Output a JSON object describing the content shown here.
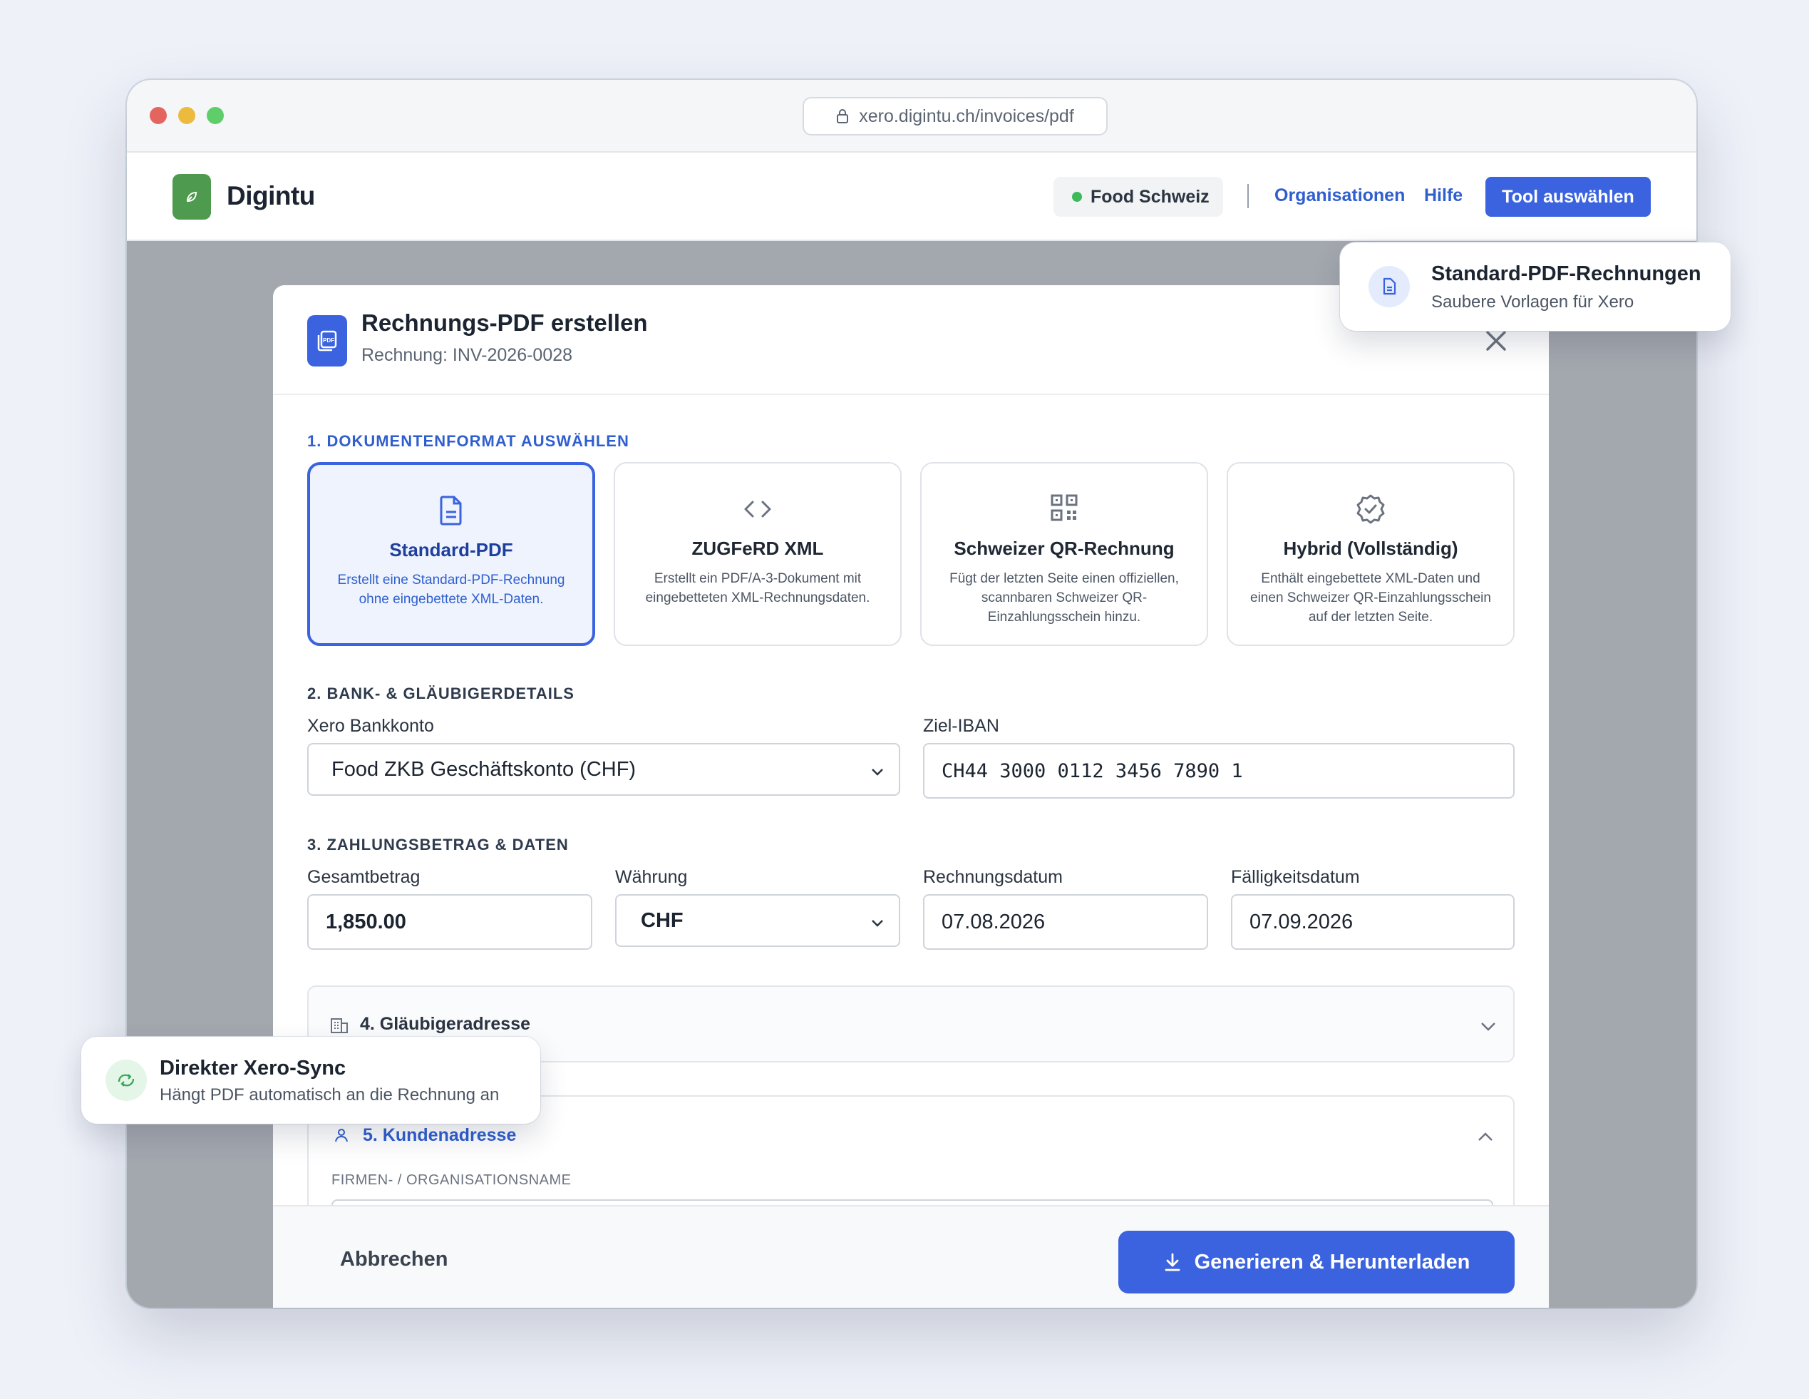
{
  "browser": {
    "url": "xero.digintu.ch/invoices/pdf",
    "dots": [
      "#e4655f",
      "#ecba3c",
      "#5fcd6a"
    ]
  },
  "header": {
    "brand": "Digintu",
    "org": "Food Schweiz",
    "nav": [
      "Organisationen",
      "Hilfe"
    ],
    "tool_button": "Tool auswählen"
  },
  "modal": {
    "title": "Rechnungs-PDF erstellen",
    "subtitle": "Rechnung: INV-2026-0028",
    "section1": "1. DOKUMENTENFORMAT AUSWÄHLEN",
    "formats": [
      {
        "title": "Standard-PDF",
        "desc": "Erstellt eine Standard-PDF-Rechnung ohne eingebettete XML-Daten.",
        "icon": "file-icon",
        "selected": true
      },
      {
        "title": "ZUGFeRD XML",
        "desc": "Erstellt ein PDF/A-3-Dokument mit eingebetteten XML-Rechnungsdaten.",
        "icon": "code-icon",
        "selected": false
      },
      {
        "title": "Schweizer QR-Rechnung",
        "desc": "Fügt der letzten Seite einen offiziellen, scannbaren Schweizer QR-Einzahlungsschein hinzu.",
        "icon": "qr-icon",
        "selected": false
      },
      {
        "title": "Hybrid (Vollständig)",
        "desc": "Enthält eingebettete XML-Daten und einen Schweizer QR-Einzahlungsschein auf der letzten Seite.",
        "icon": "badge-check-icon",
        "selected": false
      }
    ],
    "section2": "2. BANK- & GLÄUBIGERDETAILS",
    "bank_label": "Xero Bankkonto",
    "bank_value": "Food ZKB Geschäftskonto (CHF)",
    "iban_label": "Ziel-IBAN",
    "iban_value": "CH44 3000 0112 3456 7890 1",
    "section3": "3. ZAHLUNGSBETRAG & DATEN",
    "amount_label": "Gesamtbetrag",
    "amount_value": "1,850.00",
    "currency_label": "Währung",
    "currency_value": "CHF",
    "invoice_date_label": "Rechnungsdatum",
    "invoice_date_value": "07.08.2026",
    "due_date_label": "Fälligkeitsdatum",
    "due_date_value": "07.09.2026",
    "section4": "4. Gläubigeradresse",
    "section5": "5. Kundenadresse",
    "company_label": "FIRMEN- / ORGANISATIONSNAME",
    "cancel": "Abbrechen",
    "generate": "Generieren & Herunterladen"
  },
  "toasts": {
    "top": {
      "title": "Standard-PDF-Rechnungen",
      "sub": "Saubere Vorlagen für Xero"
    },
    "bottom": {
      "title": "Direkter Xero-Sync",
      "sub": "Hängt PDF automatisch an die Rechnung an"
    }
  },
  "colors": {
    "accent": "#3b63df",
    "brand": "#4e9a4e",
    "status": "#3cba5c"
  }
}
